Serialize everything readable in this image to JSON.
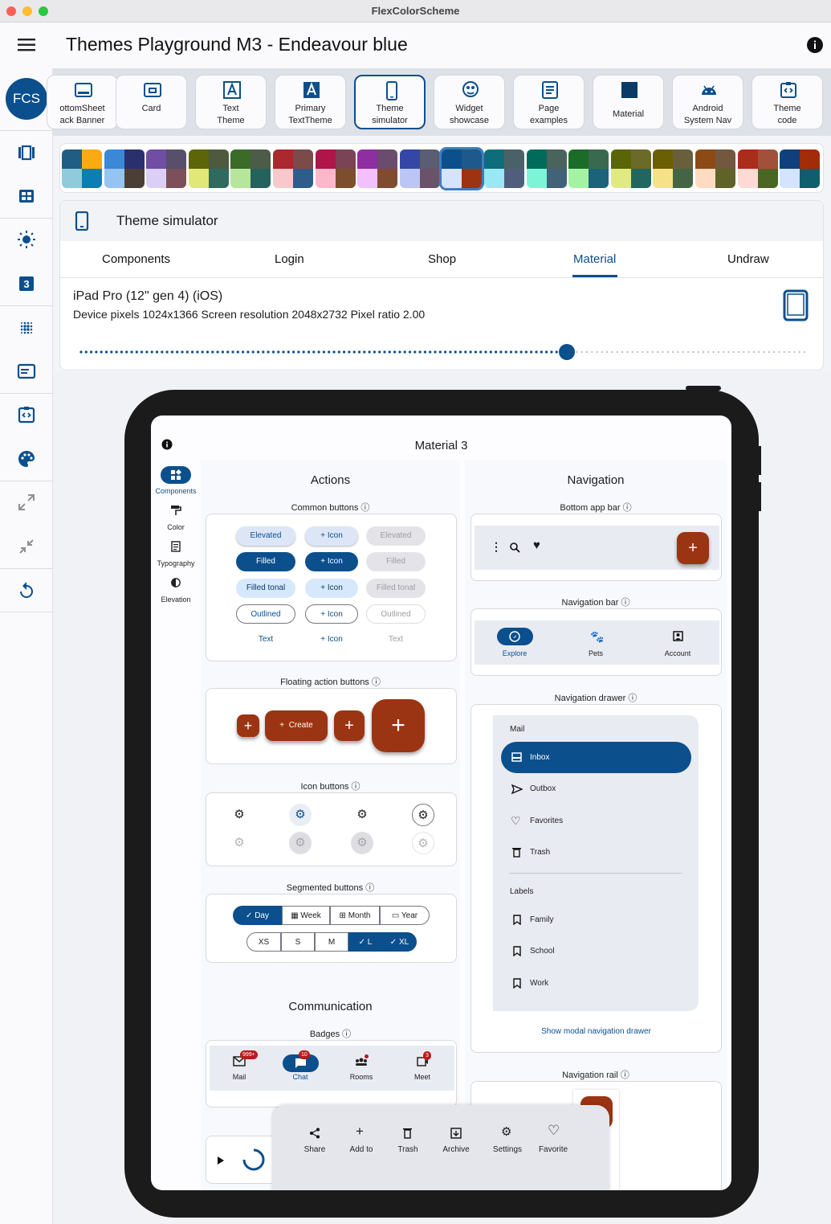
{
  "window": {
    "title": "FlexColorScheme"
  },
  "appbar": {
    "title": "Themes Playground M3 - Endeavour blue",
    "avatar": "FCS"
  },
  "toolbar": {
    "items": [
      {
        "label": "ottomSheet\nack Banner"
      },
      {
        "label": "Card"
      },
      {
        "label": "Text\nTheme"
      },
      {
        "label": "Primary\nTextTheme"
      },
      {
        "label": "Theme\nsimulator"
      },
      {
        "label": "Widget\nshowcase"
      },
      {
        "label": "Page\nexamples"
      },
      {
        "label": "Material"
      },
      {
        "label": "Android\nSystem Nav"
      },
      {
        "label": "Theme\ncode"
      }
    ]
  },
  "panel": {
    "title": "Theme simulator",
    "tabs": [
      "Components",
      "Login",
      "Shop",
      "Material",
      "Undraw"
    ],
    "active_tab": "Material",
    "device_name": "iPad Pro (12\" gen 4) (iOS)",
    "device_info": "Device pixels 1024x1366  Screen resolution 2048x2732  Pixel ratio 2.00",
    "slider_value": 0.67
  },
  "sim": {
    "title": "Material 3",
    "rail": [
      "Components",
      "Color",
      "Typography",
      "Elevation"
    ],
    "actions": {
      "title": "Actions",
      "common": "Common buttons",
      "fab": "Floating action buttons",
      "icon": "Icon buttons",
      "segmented": "Segmented buttons",
      "rows": [
        [
          "Elevated",
          "Icon",
          "Elevated"
        ],
        [
          "Filled",
          "Icon",
          "Filled"
        ],
        [
          "Filled tonal",
          "Icon",
          "Filled tonal"
        ],
        [
          "Outlined",
          "Icon",
          "Outlined"
        ],
        [
          "Text",
          "Icon",
          "Text"
        ]
      ],
      "create": "Create",
      "seg1": [
        "Day",
        "Week",
        "Month",
        "Year"
      ],
      "seg2": [
        "XS",
        "S",
        "M",
        "L",
        "XL"
      ]
    },
    "navigation": {
      "title": "Navigation",
      "bottom_app_bar": "Bottom app bar",
      "nav_bar": "Navigation bar",
      "nav_items": [
        "Explore",
        "Pets",
        "Account"
      ],
      "drawer": "Navigation drawer",
      "drawer_header": "Mail",
      "drawer_items": [
        "Inbox",
        "Outbox",
        "Favorites",
        "Trash"
      ],
      "labels_header": "Labels",
      "labels": [
        "Family",
        "School",
        "Work"
      ],
      "show_modal": "Show modal navigation drawer",
      "nav_rail": "Navigation rail"
    },
    "communication": {
      "title": "Communication",
      "badges": "Badges",
      "badge_items": [
        {
          "label": "Mail",
          "count": "999+"
        },
        {
          "label": "Chat",
          "count": "10"
        },
        {
          "label": "Rooms",
          "count": ""
        },
        {
          "label": "Meet",
          "count": "3"
        }
      ]
    },
    "sheet": [
      "Share",
      "Add to",
      "Trash",
      "Archive",
      "Settings",
      "Favorite"
    ]
  },
  "colors": {
    "primary": "#0b4f8d",
    "tertiary": "#9b3412",
    "secondaryContainer": "#d6e3ff"
  }
}
